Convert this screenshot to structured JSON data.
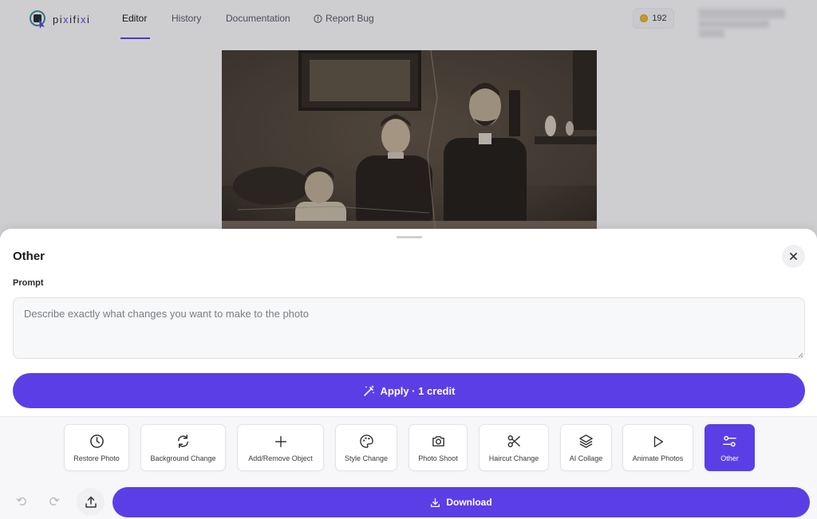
{
  "header": {
    "logo_text_left": "pi",
    "logo_text_x1": "x",
    "logo_text_mid": "ifi",
    "logo_text_x2": "x",
    "logo_text_right": "i",
    "nav": [
      {
        "label": "Editor",
        "active": true
      },
      {
        "label": "History",
        "active": false
      },
      {
        "label": "Documentation",
        "active": false
      },
      {
        "label": "Report Bug",
        "active": false
      }
    ],
    "credits": "192"
  },
  "sheet": {
    "title": "Other",
    "prompt_label": "Prompt",
    "prompt_placeholder": "Describe exactly what changes you want to make to the photo",
    "prompt_value": "",
    "apply_label": "Apply · 1 credit"
  },
  "tools": [
    {
      "label": "Restore Photo",
      "icon": "clock-icon"
    },
    {
      "label": "Background Change",
      "icon": "refresh-icon"
    },
    {
      "label": "Add/Remove Object",
      "icon": "plus-icon"
    },
    {
      "label": "Style Change",
      "icon": "palette-icon"
    },
    {
      "label": "Photo Shoot",
      "icon": "camera-icon"
    },
    {
      "label": "Haircut Change",
      "icon": "scissors-icon"
    },
    {
      "label": "AI Collage",
      "icon": "layers-icon"
    },
    {
      "label": "Animate Photos",
      "icon": "play-icon"
    },
    {
      "label": "Other",
      "icon": "sliders-icon",
      "active": true
    }
  ],
  "bottom": {
    "download_label": "Download"
  },
  "colors": {
    "accent": "#5b3ee6",
    "background": "#f3f3f5"
  }
}
